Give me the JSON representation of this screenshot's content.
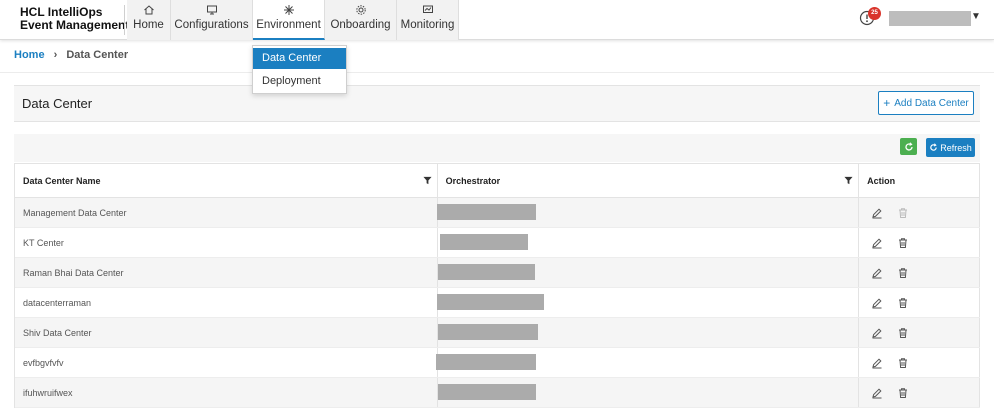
{
  "brand": {
    "line1": "HCL IntelliOps",
    "line2": "Event Management"
  },
  "nav": [
    {
      "label": "Home",
      "icon": "home-icon"
    },
    {
      "label": "Configurations",
      "icon": "config-icon"
    },
    {
      "label": "Environment",
      "icon": "environment-icon"
    },
    {
      "label": "Onboarding",
      "icon": "gear-icon"
    },
    {
      "label": "Monitoring",
      "icon": "monitor-icon"
    }
  ],
  "alert": {
    "count": "25"
  },
  "dropdown": {
    "items": [
      "Data Center",
      "Deployment"
    ]
  },
  "breadcrumb": {
    "home": "Home",
    "current": "Data Center"
  },
  "panel": {
    "title": "Data Center",
    "add_label": "Add Data Center"
  },
  "toolbar": {
    "refresh_label": "Refresh"
  },
  "table": {
    "headers": [
      "Data Center Name",
      "Orchestrator",
      "Action"
    ],
    "rows": [
      "Management Data Center",
      "KT Center",
      "Raman Bhai Data Center",
      "datacenterraman",
      "Shiv Data Center",
      "evfbgvfvfv",
      "ifuhwruifwex"
    ]
  },
  "colors": {
    "accent": "#1b7fc1",
    "green": "#4caf50",
    "badge": "#d9342b"
  }
}
